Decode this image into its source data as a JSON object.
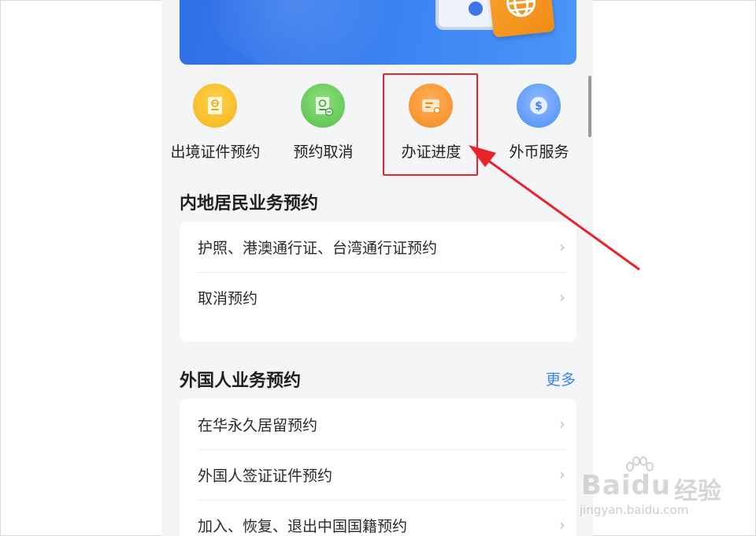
{
  "quick_actions": [
    {
      "label": "出境证件预约",
      "icon": "passport-book-icon",
      "color": "#f5b51c"
    },
    {
      "label": "预约取消",
      "icon": "passport-cancel-icon",
      "color": "#55c04a"
    },
    {
      "label": "办证进度",
      "icon": "progress-card-icon",
      "color": "#f58a1f"
    },
    {
      "label": "外币服务",
      "icon": "dollar-coin-icon",
      "color": "#4d8cf6"
    }
  ],
  "sections": {
    "mainland": {
      "title": "内地居民业务预约",
      "items": [
        "护照、港澳通行证、台湾通行证预约",
        "取消预约"
      ]
    },
    "foreigner": {
      "title": "外国人业务预约",
      "more_label": "更多",
      "items": [
        "在华永久居留预约",
        "外国人签证证件预约",
        "加入、恢复、退出中国国籍预约"
      ]
    }
  },
  "chevron": "›",
  "annotation": {
    "color": "#e8232b",
    "target": "办证进度"
  },
  "watermark": {
    "main": "Bai",
    "main2": "du",
    "cn": "经验",
    "sub": "jingyan.baidu.com"
  }
}
